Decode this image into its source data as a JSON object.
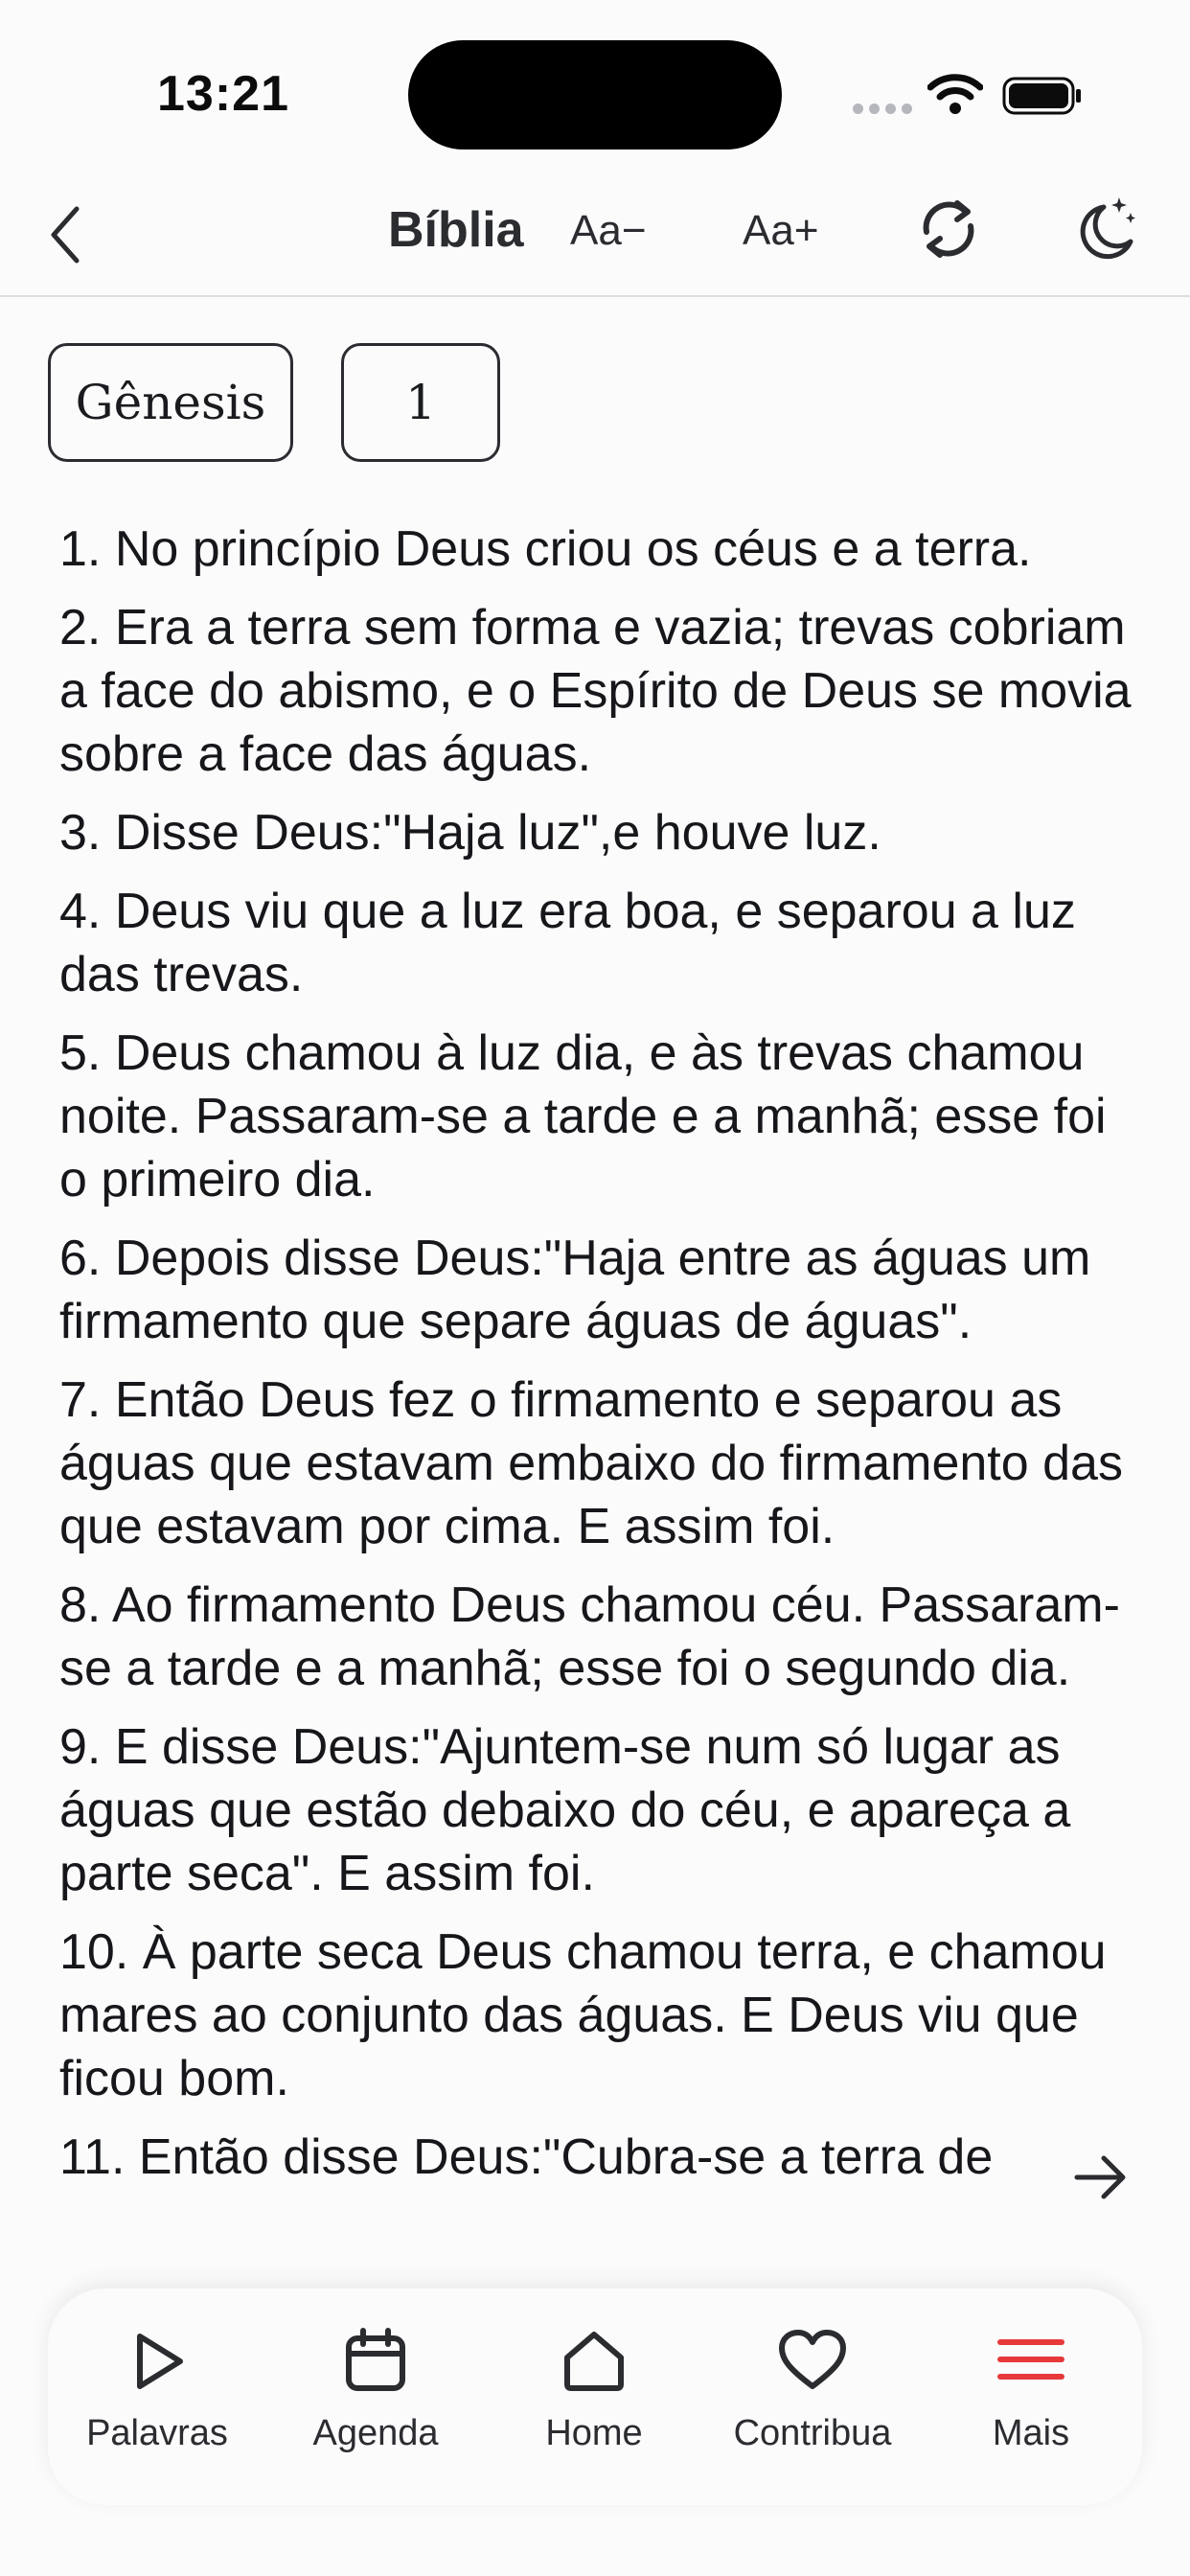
{
  "status_bar": {
    "time": "13:21"
  },
  "header": {
    "title": "Bíblia",
    "font_decrease_label": "Aa−",
    "font_increase_label": "Aa+"
  },
  "selectors": {
    "book": "Gênesis",
    "chapter": "1"
  },
  "verses": [
    "1. No princípio Deus criou os céus e a terra.",
    "2. Era a terra sem forma e vazia; trevas cobriam a face do abismo, e o Espírito de Deus se movia sobre a face das águas.",
    "3. Disse Deus:\"Haja luz\",e houve luz.",
    "4. Deus viu que a luz era boa, e separou a luz das trevas.",
    "5. Deus chamou à luz dia, e às trevas chamou noite. Passaram-se a tarde e a manhã; esse foi o primeiro dia.",
    "6. Depois disse Deus:\"Haja entre as águas um firmamento que separe águas de águas\".",
    "7. Então Deus fez o firmamento e separou as águas que estavam embaixo do firmamento das que estavam por cima. E assim foi.",
    "8. Ao firmamento Deus chamou céu. Passaram-se a tarde e a manhã; esse foi o segundo dia.",
    "9. E disse Deus:\"Ajuntem-se num só lugar as águas que estão debaixo do céu, e apareça a parte seca\". E assim foi.",
    "10. À parte seca Deus chamou terra, e chamou mares ao conjunto das águas. E Deus viu que ficou bom.",
    "11. Então disse Deus:\"Cubra-se a terra de"
  ],
  "bottom_nav": {
    "items": [
      {
        "label": "Palavras",
        "icon": "play-icon"
      },
      {
        "label": "Agenda",
        "icon": "calendar-icon"
      },
      {
        "label": "Home",
        "icon": "home-icon"
      },
      {
        "label": "Contribua",
        "icon": "heart-icon"
      },
      {
        "label": "Mais",
        "icon": "menu-icon"
      }
    ]
  },
  "colors": {
    "accent_menu": "#e8393a",
    "text": "#16171a",
    "background": "#fbfbfc"
  }
}
